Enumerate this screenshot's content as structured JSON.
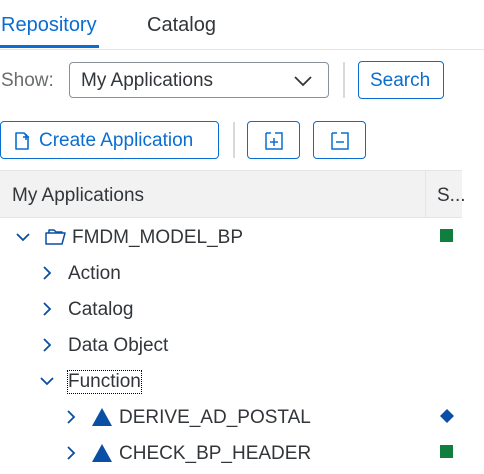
{
  "tabs": [
    {
      "label": "Repository",
      "active": true
    },
    {
      "label": "Catalog",
      "active": false
    }
  ],
  "filter": {
    "show_label": "Show:",
    "selected": "My Applications",
    "search_label": "Search"
  },
  "toolbar": {
    "create_label": "Create Application",
    "expand_icon": "expand-all-icon",
    "collapse_icon": "collapse-all-icon"
  },
  "table": {
    "col_main": "My Applications",
    "col_status": "S..."
  },
  "tree": [
    {
      "label": "FMDM_MODEL_BP",
      "level": 0,
      "expanded": true,
      "icon": "application-folder-icon",
      "status": "green-square"
    },
    {
      "label": "Action",
      "level": 1,
      "expanded": false
    },
    {
      "label": "Catalog",
      "level": 1,
      "expanded": false
    },
    {
      "label": "Data Object",
      "level": 1,
      "expanded": false
    },
    {
      "label": "Function",
      "level": 1,
      "expanded": true,
      "focused": true
    },
    {
      "label": "DERIVE_AD_POSTAL",
      "level": 2,
      "expanded": false,
      "icon": "function-triangle-icon",
      "status": "blue-diamond"
    },
    {
      "label": "CHECK_BP_HEADER",
      "level": 2,
      "expanded": false,
      "icon": "function-triangle-icon",
      "status": "green-square"
    }
  ],
  "colors": {
    "accent": "#0a6ed1",
    "status_green": "#107e3e",
    "status_blue": "#0a4ea6",
    "triangle": "#0a4ea6"
  }
}
